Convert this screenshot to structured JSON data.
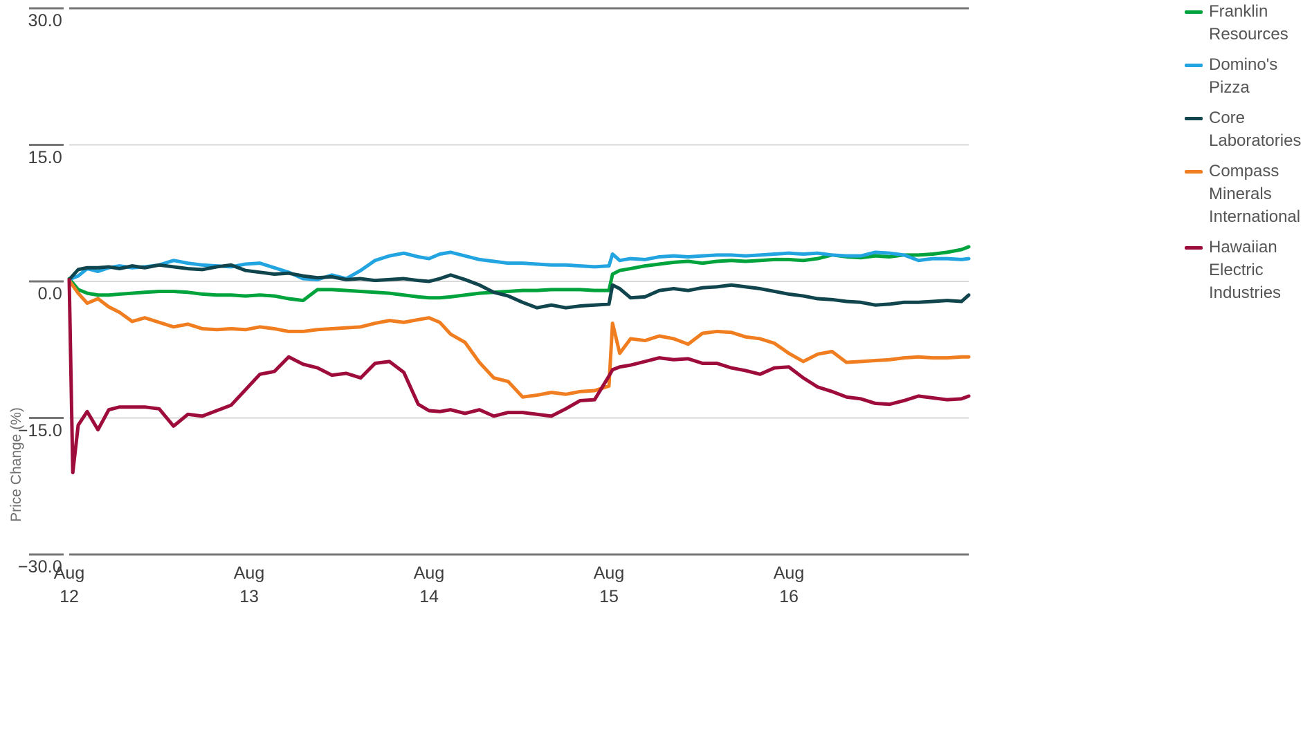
{
  "chart_data": {
    "type": "line",
    "title": "",
    "xlabel": "",
    "ylabel": "Price Change (%)",
    "ylim": [
      -30.0,
      30.0
    ],
    "yticks": [
      "30.0",
      "15.0",
      "0.0",
      "−15.0",
      "−30.0"
    ],
    "ytick_values": [
      30.0,
      15.0,
      0.0,
      -15.0,
      -30.0
    ],
    "xticks": [
      {
        "month": "Aug",
        "day": "12"
      },
      {
        "month": "Aug",
        "day": "13"
      },
      {
        "month": "Aug",
        "day": "14"
      },
      {
        "month": "Aug",
        "day": "15"
      },
      {
        "month": "Aug",
        "day": "16"
      }
    ],
    "grid": "horizontal-light",
    "legend_position": "right",
    "x_domain": [
      0,
      5.0
    ],
    "series": [
      {
        "name": "Franklin Resources",
        "color": "#00a33c",
        "x": [
          0.0,
          0.05,
          0.1,
          0.16,
          0.22,
          0.28,
          0.35,
          0.42,
          0.5,
          0.58,
          0.66,
          0.74,
          0.82,
          0.9,
          0.98,
          1.06,
          1.14,
          1.22,
          1.3,
          1.38,
          1.46,
          1.54,
          1.62,
          1.7,
          1.78,
          1.86,
          1.94,
          2.0,
          2.06,
          2.12,
          2.2,
          2.28,
          2.36,
          2.44,
          2.52,
          2.6,
          2.68,
          2.76,
          2.84,
          2.92,
          3.0,
          3.02,
          3.06,
          3.12,
          3.2,
          3.28,
          3.36,
          3.44,
          3.52,
          3.6,
          3.68,
          3.76,
          3.84,
          3.92,
          4.0,
          4.08,
          4.16,
          4.24,
          4.32,
          4.4,
          4.48,
          4.56,
          4.64,
          4.72,
          4.8,
          4.88,
          4.96,
          5.0
        ],
        "y": [
          0.3,
          -0.9,
          -1.3,
          -1.5,
          -1.5,
          -1.4,
          -1.3,
          -1.2,
          -1.1,
          -1.1,
          -1.2,
          -1.4,
          -1.5,
          -1.5,
          -1.6,
          -1.5,
          -1.6,
          -1.9,
          -2.1,
          -0.9,
          -0.9,
          -1.0,
          -1.1,
          -1.2,
          -1.3,
          -1.5,
          -1.7,
          -1.8,
          -1.8,
          -1.7,
          -1.5,
          -1.3,
          -1.2,
          -1.1,
          -1.0,
          -1.0,
          -0.9,
          -0.9,
          -0.9,
          -1.0,
          -1.0,
          0.8,
          1.2,
          1.4,
          1.7,
          1.9,
          2.1,
          2.2,
          2.0,
          2.2,
          2.3,
          2.2,
          2.3,
          2.4,
          2.4,
          2.3,
          2.5,
          2.9,
          2.7,
          2.6,
          2.8,
          2.7,
          2.9,
          2.9,
          3.0,
          3.2,
          3.5,
          3.8
        ]
      },
      {
        "name": "Domino's Pizza",
        "color": "#21a4e0",
        "x": [
          0.0,
          0.05,
          0.1,
          0.16,
          0.22,
          0.28,
          0.35,
          0.42,
          0.5,
          0.58,
          0.66,
          0.74,
          0.82,
          0.9,
          0.98,
          1.06,
          1.14,
          1.22,
          1.3,
          1.38,
          1.46,
          1.54,
          1.62,
          1.7,
          1.78,
          1.86,
          1.94,
          2.0,
          2.06,
          2.12,
          2.2,
          2.28,
          2.36,
          2.44,
          2.52,
          2.6,
          2.68,
          2.76,
          2.84,
          2.92,
          3.0,
          3.02,
          3.06,
          3.12,
          3.2,
          3.28,
          3.36,
          3.44,
          3.52,
          3.6,
          3.68,
          3.76,
          3.84,
          3.92,
          4.0,
          4.08,
          4.16,
          4.24,
          4.32,
          4.4,
          4.48,
          4.56,
          4.64,
          4.72,
          4.8,
          4.88,
          4.96,
          5.0
        ],
        "y": [
          0.2,
          0.6,
          1.4,
          1.1,
          1.5,
          1.7,
          1.5,
          1.6,
          1.8,
          2.3,
          2.0,
          1.8,
          1.7,
          1.6,
          1.9,
          2.0,
          1.5,
          1.0,
          0.3,
          0.2,
          0.7,
          0.3,
          1.2,
          2.3,
          2.8,
          3.1,
          2.7,
          2.5,
          3.0,
          3.2,
          2.8,
          2.4,
          2.2,
          2.0,
          2.0,
          1.9,
          1.8,
          1.8,
          1.7,
          1.6,
          1.7,
          3.0,
          2.3,
          2.5,
          2.4,
          2.7,
          2.8,
          2.7,
          2.8,
          2.9,
          2.9,
          2.8,
          2.9,
          3.0,
          3.1,
          3.0,
          3.1,
          2.9,
          2.8,
          2.8,
          3.2,
          3.1,
          2.9,
          2.3,
          2.5,
          2.5,
          2.4,
          2.5
        ]
      },
      {
        "name": "Core Laboratories",
        "color": "#10454d",
        "x": [
          0.0,
          0.05,
          0.1,
          0.16,
          0.22,
          0.28,
          0.35,
          0.42,
          0.5,
          0.58,
          0.66,
          0.74,
          0.82,
          0.9,
          0.98,
          1.06,
          1.14,
          1.22,
          1.3,
          1.38,
          1.46,
          1.54,
          1.62,
          1.7,
          1.78,
          1.86,
          1.94,
          2.0,
          2.06,
          2.12,
          2.2,
          2.28,
          2.36,
          2.44,
          2.52,
          2.6,
          2.68,
          2.76,
          2.84,
          2.92,
          3.0,
          3.02,
          3.06,
          3.12,
          3.2,
          3.28,
          3.36,
          3.44,
          3.52,
          3.6,
          3.68,
          3.76,
          3.84,
          3.92,
          4.0,
          4.08,
          4.16,
          4.24,
          4.32,
          4.4,
          4.48,
          4.56,
          4.64,
          4.72,
          4.8,
          4.88,
          4.96,
          5.0
        ],
        "y": [
          0.2,
          1.3,
          1.5,
          1.5,
          1.6,
          1.4,
          1.7,
          1.5,
          1.8,
          1.6,
          1.4,
          1.3,
          1.6,
          1.8,
          1.2,
          1.0,
          0.8,
          0.9,
          0.6,
          0.4,
          0.5,
          0.2,
          0.3,
          0.1,
          0.2,
          0.3,
          0.1,
          0.0,
          0.3,
          0.7,
          0.2,
          -0.4,
          -1.2,
          -1.6,
          -2.3,
          -2.9,
          -2.6,
          -2.9,
          -2.7,
          -2.6,
          -2.5,
          -0.4,
          -0.8,
          -1.8,
          -1.7,
          -1.0,
          -0.8,
          -1.0,
          -0.7,
          -0.6,
          -0.4,
          -0.6,
          -0.8,
          -1.1,
          -1.4,
          -1.6,
          -1.9,
          -2.0,
          -2.2,
          -2.3,
          -2.6,
          -2.5,
          -2.3,
          -2.3,
          -2.2,
          -2.1,
          -2.2,
          -1.5
        ]
      },
      {
        "name": "Compass Minerals International",
        "color": "#f07e20",
        "x": [
          0.0,
          0.05,
          0.1,
          0.16,
          0.22,
          0.28,
          0.35,
          0.42,
          0.5,
          0.58,
          0.66,
          0.74,
          0.82,
          0.9,
          0.98,
          1.06,
          1.14,
          1.22,
          1.3,
          1.38,
          1.46,
          1.54,
          1.62,
          1.7,
          1.78,
          1.86,
          1.94,
          2.0,
          2.06,
          2.12,
          2.2,
          2.28,
          2.36,
          2.44,
          2.52,
          2.6,
          2.68,
          2.76,
          2.84,
          2.92,
          3.0,
          3.02,
          3.06,
          3.12,
          3.2,
          3.28,
          3.36,
          3.44,
          3.52,
          3.6,
          3.68,
          3.76,
          3.84,
          3.92,
          4.0,
          4.08,
          4.16,
          4.24,
          4.32,
          4.4,
          4.48,
          4.56,
          4.64,
          4.72,
          4.8,
          4.88,
          4.96,
          5.0
        ],
        "y": [
          0.1,
          -1.3,
          -2.4,
          -1.9,
          -2.8,
          -3.4,
          -4.4,
          -4.0,
          -4.5,
          -5.0,
          -4.7,
          -5.2,
          -5.3,
          -5.2,
          -5.3,
          -5.0,
          -5.2,
          -5.5,
          -5.5,
          -5.3,
          -5.2,
          -5.1,
          -5.0,
          -4.6,
          -4.3,
          -4.5,
          -4.2,
          -4.0,
          -4.5,
          -5.8,
          -6.7,
          -8.9,
          -10.6,
          -11.0,
          -12.7,
          -12.5,
          -12.2,
          -12.4,
          -12.1,
          -12.0,
          -11.5,
          -4.6,
          -7.9,
          -6.3,
          -6.5,
          -6.0,
          -6.3,
          -6.9,
          -5.7,
          -5.5,
          -5.6,
          -6.1,
          -6.3,
          -6.8,
          -7.9,
          -8.8,
          -8.0,
          -7.7,
          -8.9,
          -8.8,
          -8.7,
          -8.6,
          -8.4,
          -8.3,
          -8.4,
          -8.4,
          -8.3,
          -8.3
        ]
      },
      {
        "name": "Hawaiian Electric Industries",
        "color": "#9d0c3a",
        "x": [
          0.0,
          0.02,
          0.05,
          0.1,
          0.16,
          0.22,
          0.28,
          0.35,
          0.42,
          0.5,
          0.58,
          0.66,
          0.74,
          0.82,
          0.9,
          0.98,
          1.06,
          1.14,
          1.22,
          1.3,
          1.38,
          1.46,
          1.54,
          1.62,
          1.7,
          1.78,
          1.86,
          1.94,
          2.0,
          2.06,
          2.12,
          2.2,
          2.28,
          2.36,
          2.44,
          2.52,
          2.6,
          2.68,
          2.76,
          2.84,
          2.92,
          3.0,
          3.02,
          3.06,
          3.12,
          3.2,
          3.28,
          3.36,
          3.44,
          3.52,
          3.6,
          3.68,
          3.76,
          3.84,
          3.92,
          4.0,
          4.08,
          4.16,
          4.24,
          4.32,
          4.4,
          4.48,
          4.56,
          4.64,
          4.72,
          4.8,
          4.88,
          4.96,
          5.0
        ],
        "y": [
          0.2,
          -21.0,
          -15.8,
          -14.3,
          -16.3,
          -14.1,
          -13.8,
          -13.8,
          -13.8,
          -14.0,
          -15.9,
          -14.6,
          -14.8,
          -14.2,
          -13.6,
          -11.9,
          -10.2,
          -9.9,
          -8.3,
          -9.1,
          -9.5,
          -10.3,
          -10.1,
          -10.6,
          -9.0,
          -8.8,
          -10.0,
          -13.5,
          -14.2,
          -14.3,
          -14.1,
          -14.5,
          -14.1,
          -14.8,
          -14.4,
          -14.4,
          -14.6,
          -14.8,
          -14.0,
          -13.1,
          -13.0,
          -10.4,
          -9.7,
          -9.4,
          -9.2,
          -8.8,
          -8.4,
          -8.6,
          -8.5,
          -9.0,
          -9.0,
          -9.5,
          -9.8,
          -10.2,
          -9.5,
          -9.4,
          -10.6,
          -11.6,
          -12.1,
          -12.7,
          -12.9,
          -13.4,
          -13.5,
          -13.1,
          -12.6,
          -12.8,
          -13.0,
          -12.9,
          -12.6
        ]
      }
    ]
  },
  "legend": {
    "items": [
      {
        "label": "Franklin Resources",
        "color": "#00a33c"
      },
      {
        "label": "Domino's Pizza",
        "color": "#21a4e0"
      },
      {
        "label": "Core Laboratories",
        "color": "#10454d"
      },
      {
        "label": "Compass Minerals International",
        "color": "#f07e20"
      },
      {
        "label": "Hawaiian Electric Industries",
        "color": "#9d0c3a"
      }
    ]
  },
  "axes": {
    "ylabel": "Price Change (%)",
    "ytick_labels": [
      "30.0",
      "15.0",
      "0.0",
      "−15.0",
      "−30.0"
    ],
    "xtick_months": [
      "Aug",
      "Aug",
      "Aug",
      "Aug",
      "Aug"
    ],
    "xtick_days": [
      "12",
      "13",
      "14",
      "15",
      "16"
    ]
  },
  "colors": {
    "axis_line": "#767676",
    "grid_line": "#d9d9d9",
    "tick_text": "#3e3e3e",
    "legend_text": "#555555",
    "axis_label": "#6f6f6f",
    "background": "#ffffff"
  }
}
